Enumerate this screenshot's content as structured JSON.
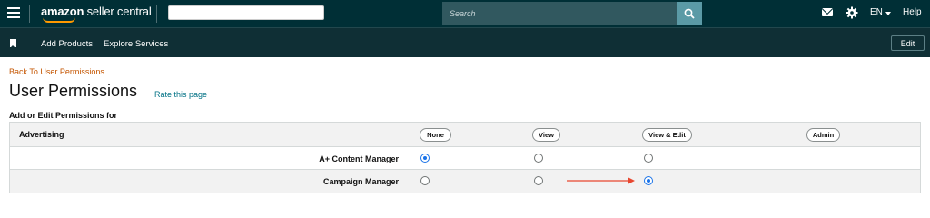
{
  "header": {
    "logo_bold": "amazon",
    "logo_light": "seller central",
    "search_placeholder": "Search",
    "language": "EN",
    "help_label": "Help",
    "icons": [
      "menu-icon",
      "search-icon",
      "mail-icon",
      "gear-icon",
      "caret-down-icon"
    ]
  },
  "subnav": {
    "items": [
      {
        "label": "Add Products"
      },
      {
        "label": "Explore Services"
      }
    ],
    "edit_label": "Edit"
  },
  "page": {
    "back_link": "Back To User Permissions",
    "title": "User Permissions",
    "rate_link": "Rate this page",
    "section_label": "Add or Edit Permissions for"
  },
  "permissions": {
    "category": "Advertising",
    "columns": [
      "None",
      "View",
      "View & Edit",
      "Admin"
    ],
    "rows": [
      {
        "name": "A+ Content Manager",
        "selected": "None"
      },
      {
        "name": "Campaign Manager",
        "selected": "View & Edit"
      }
    ]
  },
  "colors": {
    "header_bg": "#002f36",
    "subnav_bg": "#0f2f35",
    "link_orange": "#c45500",
    "link_teal": "#007185",
    "radio_selected": "#1a73e8",
    "arrow": "#e8472f"
  }
}
